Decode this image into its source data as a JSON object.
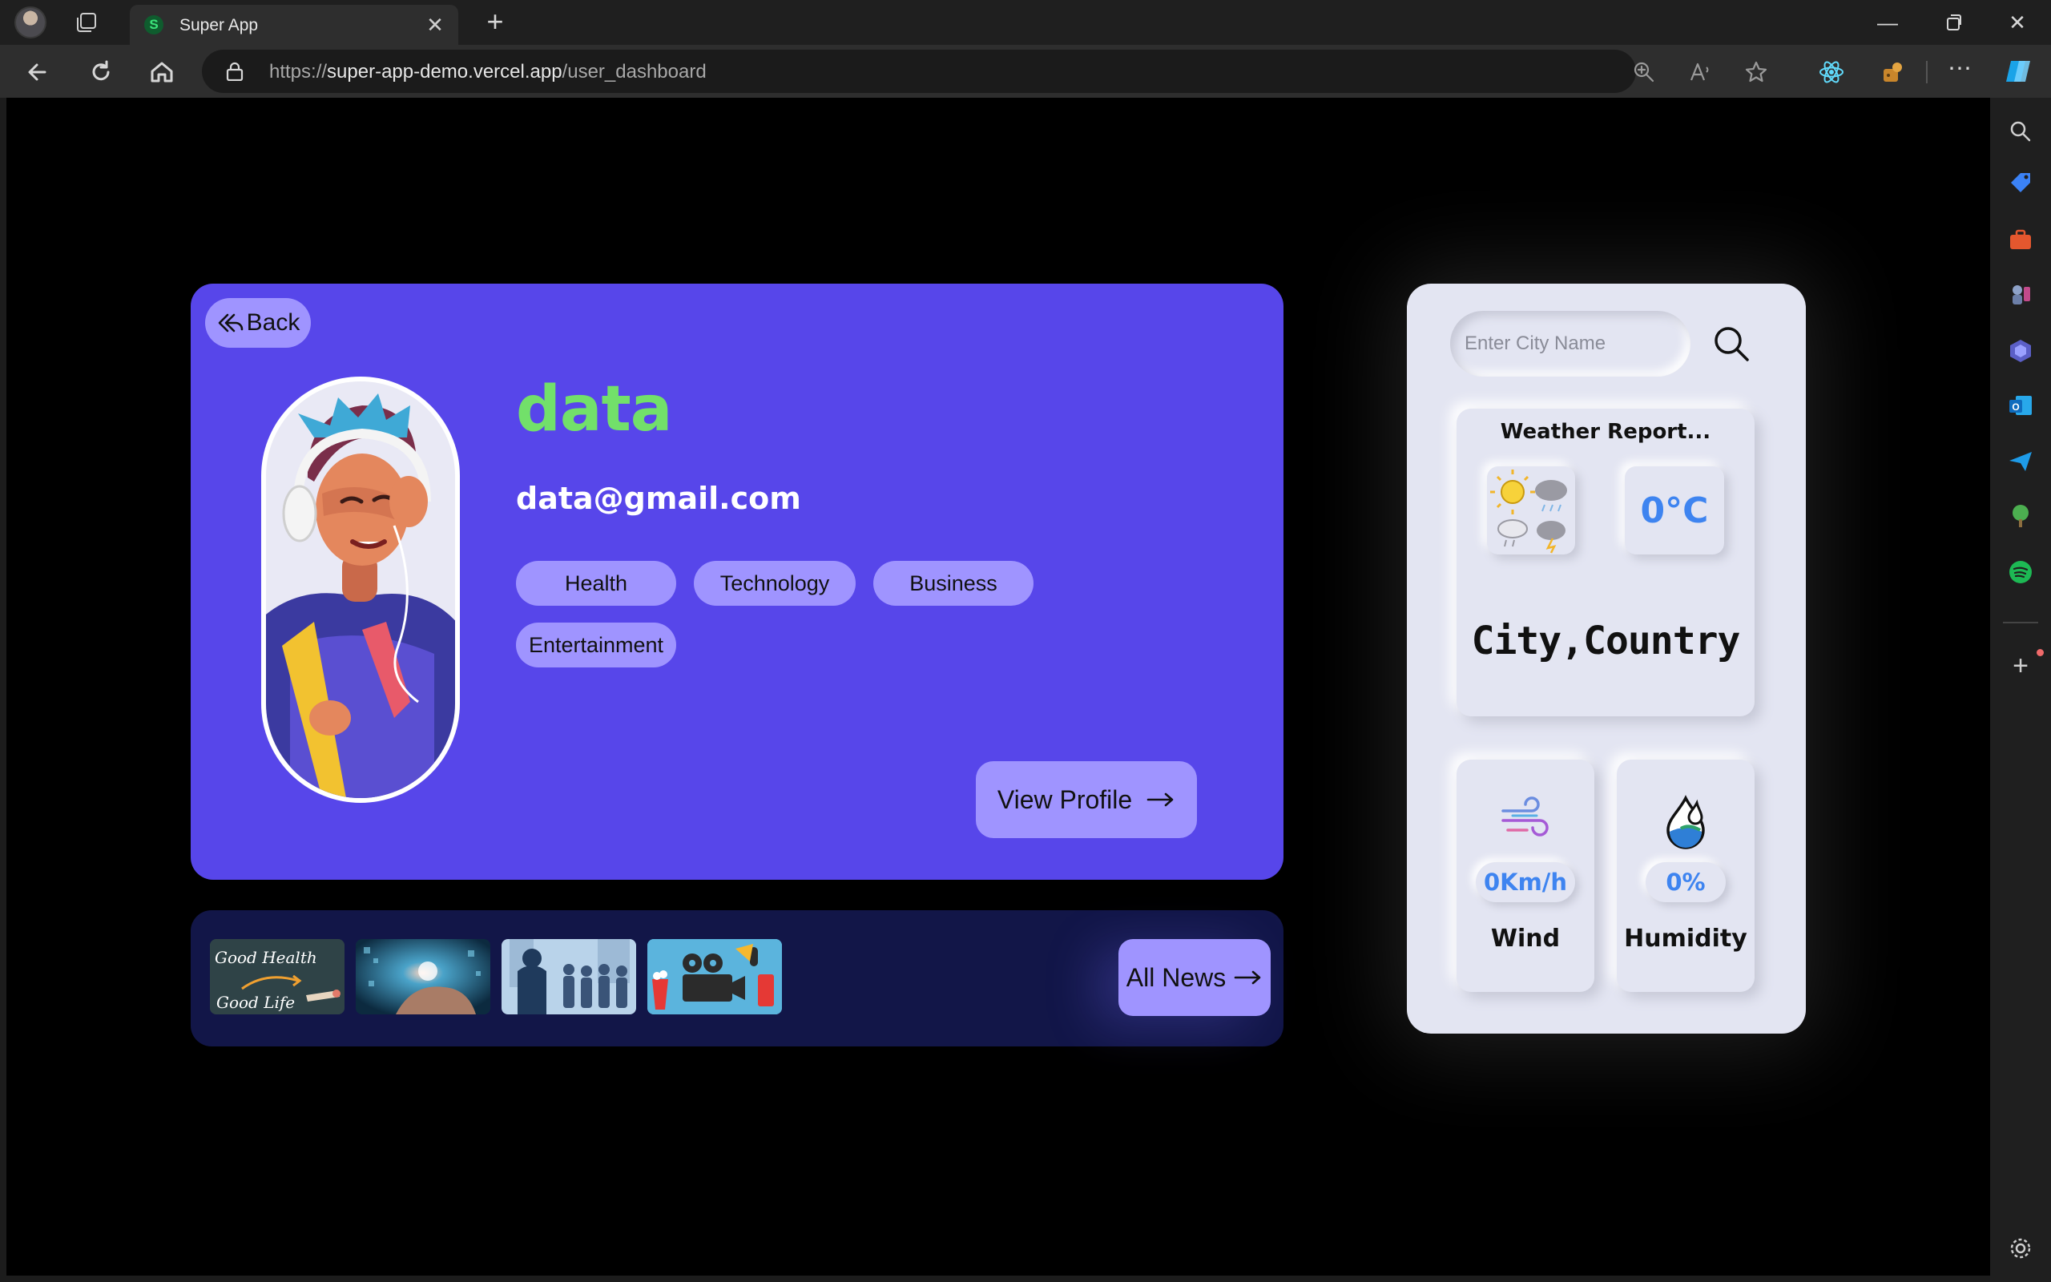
{
  "browser": {
    "tab_title": "Super App",
    "tab_favicon_letter": "S",
    "url_prefix": "https://",
    "url_host": "super-app-demo.vercel.app",
    "url_path": "/user_dashboard"
  },
  "profile": {
    "back_label": "Back",
    "name": "data",
    "email": "data@gmail.com",
    "categories": [
      "Health",
      "Technology",
      "Business",
      "Entertainment"
    ],
    "view_profile_label": "View Profile"
  },
  "news": {
    "thumb1_text_top": "Good Health",
    "thumb1_text_bottom": "Good Life",
    "all_news_label": "All News"
  },
  "weather": {
    "city_placeholder": "Enter City Name",
    "report_title": "Weather Report...",
    "temperature": "0°C",
    "location": "City,Country",
    "wind_value": "0Km/h",
    "wind_label": "Wind",
    "humidity_value": "0%",
    "humidity_label": "Humidity"
  },
  "colors": {
    "profile_card": "#5746ea",
    "chip": "#9f94ff",
    "name": "#72e06a",
    "news_strip": "#121648",
    "weather_card": "#e3e5f2",
    "accent_blue": "#3e84f0"
  }
}
